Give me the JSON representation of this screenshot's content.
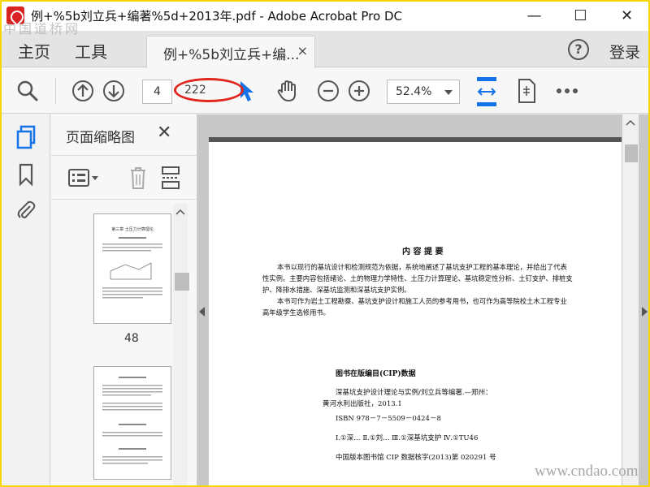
{
  "window": {
    "title": "例+%5b刘立兵+编著%5d+2013年.pdf - Adobe Acrobat Pro DC",
    "minimize_glyph": "—",
    "maximize_glyph": "☐",
    "close_glyph": "✕"
  },
  "watermark_top": "中国道桥网",
  "nav": {
    "home": "主页",
    "tools": "工具"
  },
  "tab": {
    "label": "例+%5b刘立兵+编...",
    "close": "×"
  },
  "help": "?",
  "account": {
    "login": "登录"
  },
  "toolbar": {
    "current_page": "4",
    "total_pages": "222",
    "zoom": "52.4%"
  },
  "annotation": {
    "color": "#e0261d"
  },
  "thumbnail_panel": {
    "title": "页面缩略图",
    "close": "✕",
    "thumbnails": [
      {
        "page_label": "48",
        "heading": "第三章 土压力计算理论"
      },
      {
        "page_label": "",
        "heading": ""
      }
    ]
  },
  "document": {
    "heading": "内 容 提 要",
    "summary_lines": [
      "本书以现行的基坑设计和检测规范为依据，系统地阐述了基坑支护工程的基本理论，并给出了代表",
      "性实例。主要内容包括绪论、土的物理力学特性、土压力计算理论、基坑稳定性分析、土钉支护、排桩支",
      "护、降排水措施、深基坑监测和深基坑支护实例。",
      "本书可作为岩土工程勘察、基坑支护设计和施工人员的参考用书，也可作为高等院校土木工程专业",
      "高年级学生选修用书。"
    ],
    "cip_title": "图书在版编目(CIP)数据",
    "cip_lines": [
      "深基坑支护设计理论与实例/刘立兵等编著.—郑州：",
      "黄河水利出版社，2013.1",
      "ISBN 978－7－5509－0424－8",
      "Ⅰ.①深…  Ⅱ.①刘…  Ⅲ.①深基坑支护  Ⅳ.①TU46",
      "中国版本图书馆 CIP 数据核字(2013)第 020291 号"
    ]
  },
  "watermark_bottom": "www.cndao.com",
  "colors": {
    "accent": "#1473e6",
    "frame": "#f5d800"
  }
}
